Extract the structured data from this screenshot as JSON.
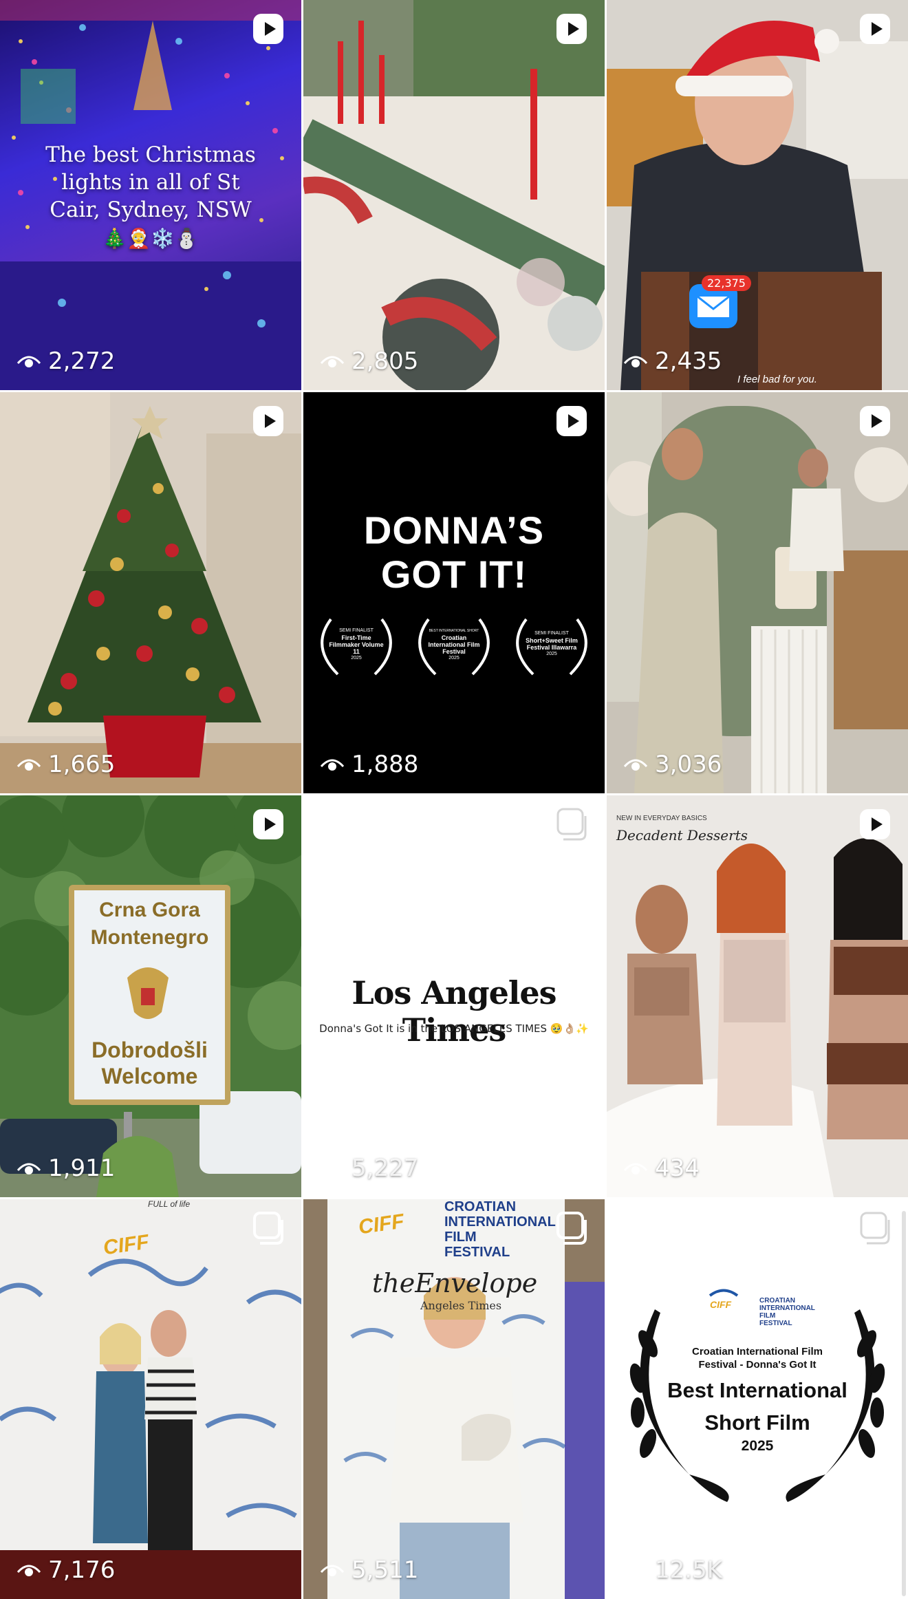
{
  "tiles": [
    {
      "views": "2,272",
      "badge": "reel",
      "overlay": "The best Christmas lights in all of St Cair, Sydney, NSW",
      "emoji": "🎄🤶❄️⛄"
    },
    {
      "views": "2,805",
      "badge": "reel"
    },
    {
      "views": "2,435",
      "badge": "reel",
      "notif_count": "22,375",
      "caption": "I feel bad for you."
    },
    {
      "views": "1,665",
      "badge": "reel"
    },
    {
      "views": "1,888",
      "badge": "reel",
      "headline_1": "DONNA’S",
      "headline_2": "GOT IT!",
      "laurels": [
        {
          "l1": "SEMI FINALIST",
          "l2": "First-Time",
          "l3": "Filmmaker Volume",
          "l4": "11",
          "l5": "2025"
        },
        {
          "l1": "BEST INTERNATIONAL SHORT",
          "l2": "Croatian",
          "l3": "International Film",
          "l4": "Festival",
          "l5": "2025"
        },
        {
          "l1": "SEMI FINALIST",
          "l2": "Short+Sweet Film",
          "l3": "Festival Illawarra",
          "l4": "",
          "l5": "2025"
        }
      ]
    },
    {
      "views": "3,036",
      "badge": "reel"
    },
    {
      "views": "1,911",
      "badge": "reel",
      "sign_1": "Crna Gora",
      "sign_2": "Montenegro",
      "sign_3": "Dobrodošli",
      "sign_4": "Welcome"
    },
    {
      "views": "5,227",
      "badge": "carousel",
      "masthead": "Los Angeles Times",
      "subline": "Donna's Got It is in the LOS ANGELES TIMES 🥹👌🏼✨"
    },
    {
      "views": "434",
      "badge": "reel",
      "tag_small": "NEW IN EVERYDAY BASICS",
      "tag_script": "Decadent Desserts"
    },
    {
      "views": "7,176",
      "badge": "carousel",
      "backdrop": "CIFF",
      "top_text": "FULL of life"
    },
    {
      "views": "5,511",
      "badge": "carousel",
      "banner_logo": "CIFF",
      "banner_1": "CROATIAN",
      "banner_2": "INTERNATIONAL",
      "banner_3": "FILM",
      "banner_4": "FESTIVAL",
      "envelope": "theEnvelope",
      "envelope_sub": "Angeles Times"
    },
    {
      "views": "12.5K",
      "badge": "carousel",
      "logo": "CIFF",
      "logo_1": "CROATIAN",
      "logo_2": "INTERNATIONAL",
      "logo_3": "FILM",
      "logo_4": "FESTIVAL",
      "award_sub_1": "Croatian International Film",
      "award_sub_2": "Festival - Donna's Got It",
      "award_1": "Best International",
      "award_2": "Short Film",
      "award_year": "2025"
    }
  ]
}
